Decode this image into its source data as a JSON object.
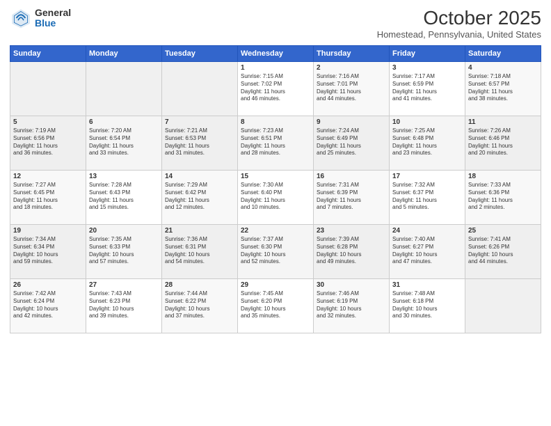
{
  "logo": {
    "general": "General",
    "blue": "Blue"
  },
  "header": {
    "month": "October 2025",
    "location": "Homestead, Pennsylvania, United States"
  },
  "days_of_week": [
    "Sunday",
    "Monday",
    "Tuesday",
    "Wednesday",
    "Thursday",
    "Friday",
    "Saturday"
  ],
  "weeks": [
    [
      {
        "num": "",
        "info": ""
      },
      {
        "num": "",
        "info": ""
      },
      {
        "num": "",
        "info": ""
      },
      {
        "num": "1",
        "info": "Sunrise: 7:15 AM\nSunset: 7:02 PM\nDaylight: 11 hours\nand 46 minutes."
      },
      {
        "num": "2",
        "info": "Sunrise: 7:16 AM\nSunset: 7:01 PM\nDaylight: 11 hours\nand 44 minutes."
      },
      {
        "num": "3",
        "info": "Sunrise: 7:17 AM\nSunset: 6:59 PM\nDaylight: 11 hours\nand 41 minutes."
      },
      {
        "num": "4",
        "info": "Sunrise: 7:18 AM\nSunset: 6:57 PM\nDaylight: 11 hours\nand 38 minutes."
      }
    ],
    [
      {
        "num": "5",
        "info": "Sunrise: 7:19 AM\nSunset: 6:56 PM\nDaylight: 11 hours\nand 36 minutes."
      },
      {
        "num": "6",
        "info": "Sunrise: 7:20 AM\nSunset: 6:54 PM\nDaylight: 11 hours\nand 33 minutes."
      },
      {
        "num": "7",
        "info": "Sunrise: 7:21 AM\nSunset: 6:53 PM\nDaylight: 11 hours\nand 31 minutes."
      },
      {
        "num": "8",
        "info": "Sunrise: 7:23 AM\nSunset: 6:51 PM\nDaylight: 11 hours\nand 28 minutes."
      },
      {
        "num": "9",
        "info": "Sunrise: 7:24 AM\nSunset: 6:49 PM\nDaylight: 11 hours\nand 25 minutes."
      },
      {
        "num": "10",
        "info": "Sunrise: 7:25 AM\nSunset: 6:48 PM\nDaylight: 11 hours\nand 23 minutes."
      },
      {
        "num": "11",
        "info": "Sunrise: 7:26 AM\nSunset: 6:46 PM\nDaylight: 11 hours\nand 20 minutes."
      }
    ],
    [
      {
        "num": "12",
        "info": "Sunrise: 7:27 AM\nSunset: 6:45 PM\nDaylight: 11 hours\nand 18 minutes."
      },
      {
        "num": "13",
        "info": "Sunrise: 7:28 AM\nSunset: 6:43 PM\nDaylight: 11 hours\nand 15 minutes."
      },
      {
        "num": "14",
        "info": "Sunrise: 7:29 AM\nSunset: 6:42 PM\nDaylight: 11 hours\nand 12 minutes."
      },
      {
        "num": "15",
        "info": "Sunrise: 7:30 AM\nSunset: 6:40 PM\nDaylight: 11 hours\nand 10 minutes."
      },
      {
        "num": "16",
        "info": "Sunrise: 7:31 AM\nSunset: 6:39 PM\nDaylight: 11 hours\nand 7 minutes."
      },
      {
        "num": "17",
        "info": "Sunrise: 7:32 AM\nSunset: 6:37 PM\nDaylight: 11 hours\nand 5 minutes."
      },
      {
        "num": "18",
        "info": "Sunrise: 7:33 AM\nSunset: 6:36 PM\nDaylight: 11 hours\nand 2 minutes."
      }
    ],
    [
      {
        "num": "19",
        "info": "Sunrise: 7:34 AM\nSunset: 6:34 PM\nDaylight: 10 hours\nand 59 minutes."
      },
      {
        "num": "20",
        "info": "Sunrise: 7:35 AM\nSunset: 6:33 PM\nDaylight: 10 hours\nand 57 minutes."
      },
      {
        "num": "21",
        "info": "Sunrise: 7:36 AM\nSunset: 6:31 PM\nDaylight: 10 hours\nand 54 minutes."
      },
      {
        "num": "22",
        "info": "Sunrise: 7:37 AM\nSunset: 6:30 PM\nDaylight: 10 hours\nand 52 minutes."
      },
      {
        "num": "23",
        "info": "Sunrise: 7:39 AM\nSunset: 6:28 PM\nDaylight: 10 hours\nand 49 minutes."
      },
      {
        "num": "24",
        "info": "Sunrise: 7:40 AM\nSunset: 6:27 PM\nDaylight: 10 hours\nand 47 minutes."
      },
      {
        "num": "25",
        "info": "Sunrise: 7:41 AM\nSunset: 6:26 PM\nDaylight: 10 hours\nand 44 minutes."
      }
    ],
    [
      {
        "num": "26",
        "info": "Sunrise: 7:42 AM\nSunset: 6:24 PM\nDaylight: 10 hours\nand 42 minutes."
      },
      {
        "num": "27",
        "info": "Sunrise: 7:43 AM\nSunset: 6:23 PM\nDaylight: 10 hours\nand 39 minutes."
      },
      {
        "num": "28",
        "info": "Sunrise: 7:44 AM\nSunset: 6:22 PM\nDaylight: 10 hours\nand 37 minutes."
      },
      {
        "num": "29",
        "info": "Sunrise: 7:45 AM\nSunset: 6:20 PM\nDaylight: 10 hours\nand 35 minutes."
      },
      {
        "num": "30",
        "info": "Sunrise: 7:46 AM\nSunset: 6:19 PM\nDaylight: 10 hours\nand 32 minutes."
      },
      {
        "num": "31",
        "info": "Sunrise: 7:48 AM\nSunset: 6:18 PM\nDaylight: 10 hours\nand 30 minutes."
      },
      {
        "num": "",
        "info": ""
      }
    ]
  ]
}
